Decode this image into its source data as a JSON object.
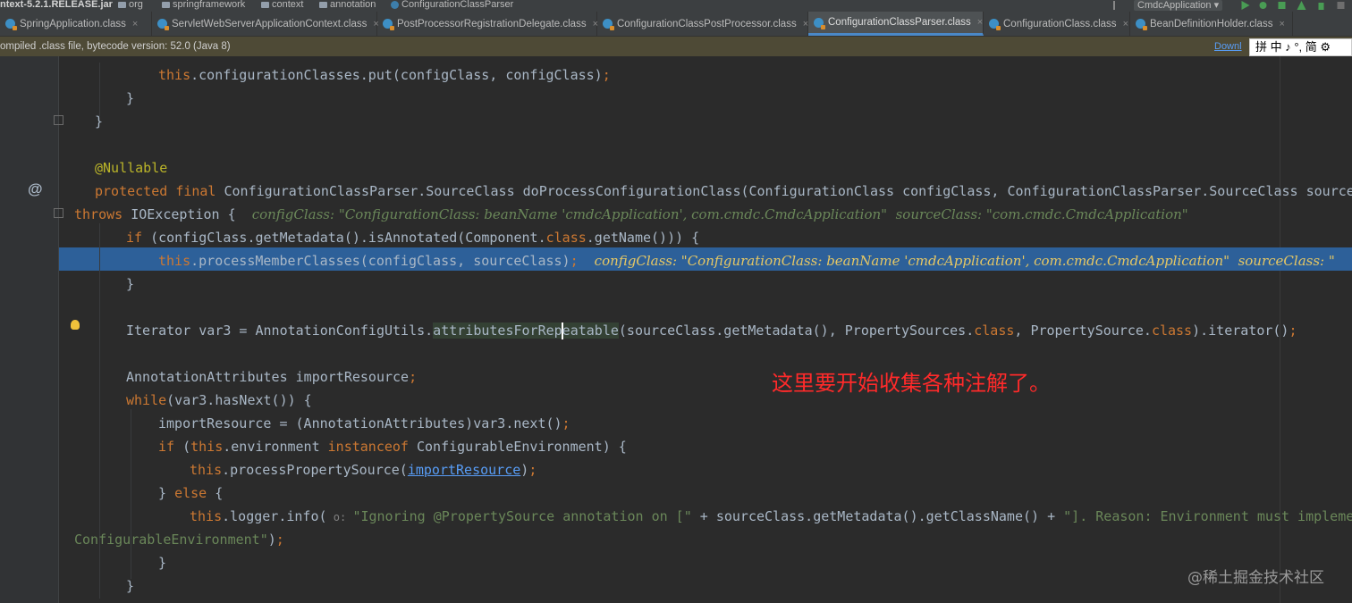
{
  "breadcrumb": {
    "items": [
      "ntext-5.2.1.RELEASE.jar",
      "org",
      "springframework",
      "context",
      "annotation",
      "ConfigurationClassParser"
    ],
    "run_config": "CmdcApplication ▾"
  },
  "tabs": [
    {
      "label": "SpringApplication.class",
      "close": "×"
    },
    {
      "label": "ServletWebServerApplicationContext.class",
      "close": "×"
    },
    {
      "label": "PostProcessorRegistrationDelegate.class",
      "close": "×"
    },
    {
      "label": "ConfigurationClassPostProcessor.class",
      "close": "×"
    },
    {
      "label": "ConfigurationClassParser.class",
      "close": "×"
    },
    {
      "label": "ConfigurationClass.class",
      "close": "×"
    },
    {
      "label": "BeanDefinitionHolder.class",
      "close": "×"
    }
  ],
  "banner": {
    "message": "ompiled .class file, bytecode version: 52.0 (Java 8)",
    "download_link": "Downl"
  },
  "ime": {
    "text": "拼 中 ♪ °, 简 ⚙"
  },
  "gutter": {
    "at_icon": "@"
  },
  "code": {
    "l1_this": "this",
    "l1_rest": ".configurationClasses.put(configClass, configClass)",
    "l1_semi": ";",
    "brace_close": "}",
    "nullable": "@Nullable",
    "sig_protected": "protected",
    "sig_final": "final",
    "sig_rest": " ConfigurationClassParser.SourceClass doProcessConfigurationClass(ConfigurationClass configClass, ConfigurationClassParser.SourceClass sourceClass)",
    "throws_kw": "throws",
    "throws_rest": " IOException {",
    "throws_hint": "configClass: \"ConfigurationClass: beanName 'cmdcApplication', com.cmdc.CmdcApplication\"  sourceClass: \"com.cmdc.CmdcApplication\"",
    "if_kw": "if",
    "if_rest": " (configClass.getMetadata().isAnnotated(Component.",
    "class_kw": "class",
    "if_tail": ".getName())) {",
    "hl_this": "this",
    "hl_rest": ".processMemberClasses(configClass, sourceClass)",
    "hl_semi": ";",
    "hl_hint": "configClass: \"ConfigurationClass: beanName 'cmdcApplication', com.cmdc.CmdcApplication\"  sourceClass: \"",
    "iter_head": "Iterator var3 = AnnotationConfigUtils.",
    "iter_usage_a": "attributesForRep",
    "iter_usage_b": "eatable",
    "iter_mid": "(sourceClass.getMetadata(), PropertySources.",
    "iter_class1": "class",
    "iter_mid2": ", PropertySource.",
    "iter_class2": "class",
    "iter_tail": ").iterator()",
    "iter_semi": ";",
    "aa_decl": "AnnotationAttributes importResource",
    "aa_semi": ";",
    "while_kw": "while",
    "while_rest": "(var3.hasNext()) {",
    "ir_assign": "importResource = (AnnotationAttributes)var3.next()",
    "ir_semi": ";",
    "if2_kw": "if",
    "if2_open": " (",
    "if2_this": "this",
    "if2_mid": ".environment ",
    "if2_instanceof": "instanceof",
    "if2_tail": " ConfigurableEnvironment) {",
    "pps_this": "this",
    "pps_mid": ".processPropertySource(",
    "pps_link": "importResource",
    "pps_tail": ")",
    "pps_semi": ";",
    "else_brace": "} ",
    "else_kw": "else",
    "else_open": " {",
    "log_this": "this",
    "log_mid": ".logger.info(",
    "log_param": " o: ",
    "log_str": "\"Ignoring @PropertySource annotation on [\"",
    "log_plus": " + sourceClass.getMetadata().getClassName() + ",
    "log_str2": "\"]. Reason: Environment must implement",
    "log_wrap_str": "ConfigurableEnvironment\"",
    "log_wrap_tail": ")",
    "log_wrap_semi": ";"
  },
  "annotation_note": "这里要开始收集各种注解了。",
  "watermark": "@稀土掘金技术社区"
}
